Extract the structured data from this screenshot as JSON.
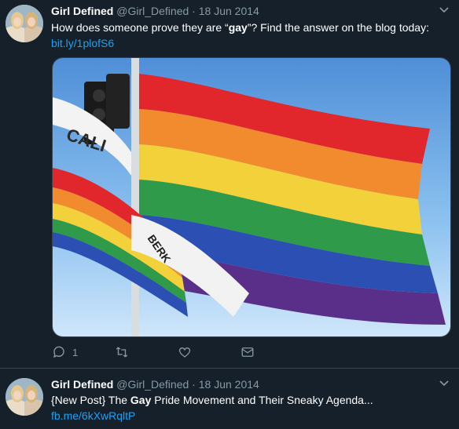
{
  "tweets": [
    {
      "author": {
        "name": "Girl Defined",
        "handle": "@Girl_Defined",
        "date": "18 Jun 2014"
      },
      "text": {
        "part1": "How does someone prove they are “",
        "highlight": "gay",
        "part2": "”? Find the answer on the blog today:",
        "link": "bit.ly/1plofS6"
      },
      "media_icon": "rainbow-flag-photo",
      "actions": {
        "reply_count": "1",
        "retweet_count": "",
        "like_count": ""
      }
    },
    {
      "author": {
        "name": "Girl Defined",
        "handle": "@Girl_Defined",
        "date": "18 Jun 2014"
      },
      "text": {
        "prefix": "{New Post} The ",
        "highlight": "Gay",
        "suffix": " Pride Movement and Their Sneaky Agenda...",
        "link": "fb.me/6kXwRqltP"
      }
    }
  ],
  "separator": "·",
  "colors": {
    "background": "#15202b",
    "divider": "#38444d",
    "secondary_text": "#8899a6",
    "link": "#1da1f2"
  }
}
